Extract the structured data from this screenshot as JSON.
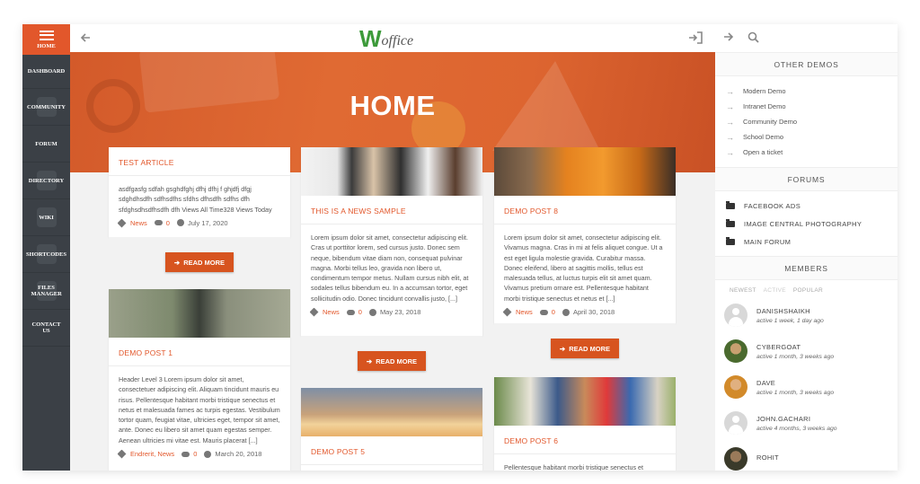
{
  "left_sidebar": {
    "home_label": "HOME",
    "items": [
      {
        "label": "DASHBOARD"
      },
      {
        "label": "COMMUNITY"
      },
      {
        "label": "FORUM"
      },
      {
        "label": "DIRECTORY"
      },
      {
        "label": "WIKI"
      },
      {
        "label": "SHORTCODES"
      },
      {
        "label": "FILES MANAGER"
      },
      {
        "label": "CONTACT US"
      }
    ],
    "colors": {
      "background": "#3b4046",
      "active": "#e2572b"
    }
  },
  "topbar": {
    "logo_letter": "W",
    "logo_text": "office",
    "icons": {
      "back": "arrow-left-icon",
      "login": "sign-in-icon"
    }
  },
  "hero": {
    "title": "HOME"
  },
  "accent_color": "#e2572b",
  "cards": [
    {
      "title": "TEST ARTICLE",
      "body": "asdfgasfg sdfah gsghdfghj dfhj dfhj f ghjdfj dfgj sdghdhsdfh sdfhsdfhs sfdhs dfhsdfh sdfhs dfh sfdghsdhsdfhsdfh dfh Views All Time328 Views Today",
      "category": "News",
      "comments": "0",
      "date": "July 17, 2020",
      "read_more": "READ MORE"
    },
    {
      "title": "DEMO POST 1",
      "body": "Header Level 3 Lorem ipsum dolor sit amet, consectetuer adipiscing elit. Aliquam tincidunt mauris eu risus. Pellentesque habitant morbi tristique senectus et netus et malesuada fames ac turpis egestas. Vestibulum tortor quam, feugiat vitae, ultricies eget, tempor sit amet, ante. Donec eu libero sit amet quam egestas semper. Aenean ultricies mi vitae est. Mauris placerat [...]",
      "category": "Endrerit, News",
      "comments": "0",
      "date": "March 20, 2018"
    },
    {
      "title": "THIS IS A NEWS SAMPLE",
      "body": "Lorem ipsum dolor sit amet, consectetur adipiscing elit. Cras ut porttitor lorem, sed cursus justo. Donec sem neque, bibendum vitae diam non, consequat pulvinar magna. Morbi tellus leo, gravida non libero ut, condimentum tempor metus. Nullam cursus nibh elit, at sodales tellus bibendum eu. In a accumsan tortor, eget sollicitudin odio. Donec tincidunt convallis justo, [...]",
      "category": "News",
      "comments": "0",
      "date": "May 23, 2018",
      "read_more": "READ MORE"
    },
    {
      "title": "DEMO POST 5"
    },
    {
      "title": "DEMO POST 8",
      "body": "Lorem ipsum dolor sit amet, consectetur adipiscing elit. Vivamus magna. Cras in mi at felis aliquet congue. Ut a est eget ligula molestie gravida. Curabitur massa. Donec eleifend, libero at sagittis mollis, tellus est malesuada tellus, at luctus turpis elit sit amet quam. Vivamus pretium ornare est. Pellentesque habitant morbi tristique senectus et netus et [...]",
      "category": "News",
      "comments": "0",
      "date": "April 30, 2018",
      "read_more": "READ MORE"
    },
    {
      "title": "DEMO POST 6",
      "body": "Pellentesque habitant morbi tristique senectus et"
    }
  ],
  "right_sidebar": {
    "icons": {
      "forward": "arrow-right-icon",
      "search": "search-icon"
    },
    "other_demos": {
      "heading": "OTHER DEMOS",
      "links": [
        "Modern Demo",
        "Intranet Demo",
        "Community Demo",
        "School Demo",
        "Open a ticket"
      ]
    },
    "forums": {
      "heading": "FORUMS",
      "items": [
        "FACEBOOK ADS",
        "IMAGE CENTRAL PHOTOGRAPHY",
        "MAIN FORUM"
      ]
    },
    "members": {
      "heading": "MEMBERS",
      "tabs": [
        "NEWEST",
        "ACTIVE",
        "POPULAR"
      ],
      "list": [
        {
          "name": "DANISHSHAIKH",
          "activity": "active 1 week, 1 day ago"
        },
        {
          "name": "CYBERGOAT",
          "activity": "active 1 month, 3 weeks ago"
        },
        {
          "name": "DAVE",
          "activity": "active 1 month, 3 weeks ago"
        },
        {
          "name": "JOHN.GACHARI",
          "activity": "active 4 months, 3 weeks ago"
        },
        {
          "name": "ROHIT",
          "activity": ""
        }
      ]
    }
  }
}
